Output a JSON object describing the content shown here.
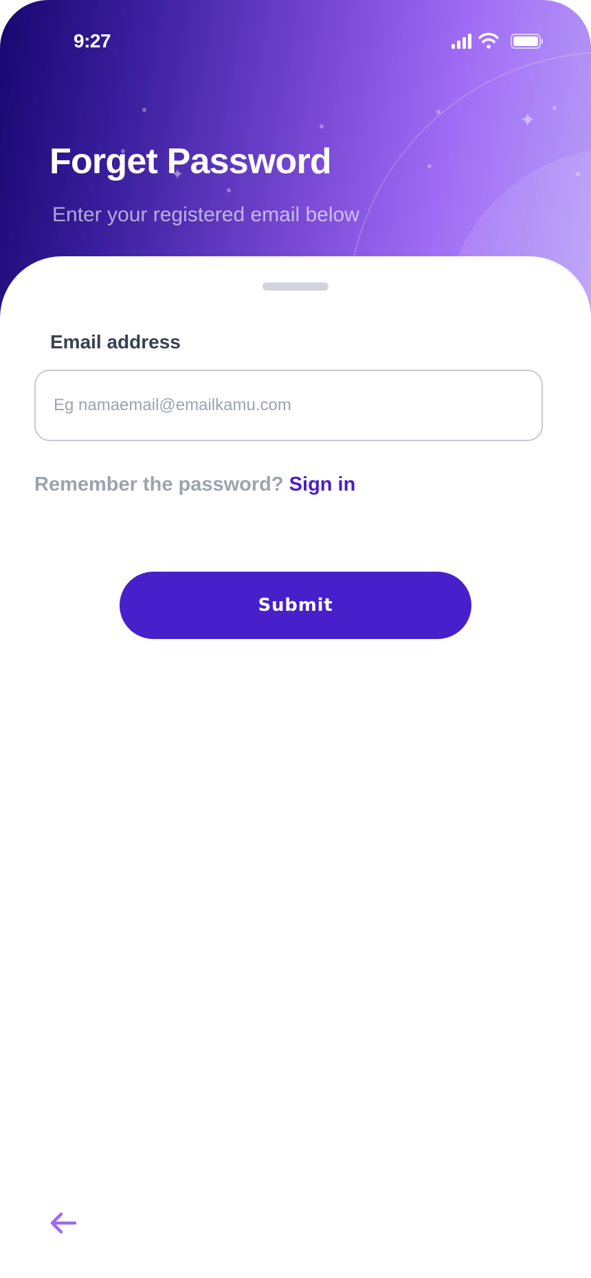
{
  "status_bar": {
    "time": "9:27",
    "icons": [
      "signal-icon",
      "wifi-icon",
      "battery-icon"
    ]
  },
  "header": {
    "title": "Forget Password",
    "subtitle": "Enter your registered email below"
  },
  "form": {
    "email_label": "Email address",
    "email_value": "",
    "email_placeholder": "Eg namaemail@emailkamu.com",
    "remember_text": "Remember the password?",
    "signin_label": "Sign in",
    "submit_label": "Submit"
  },
  "footer": {
    "back_icon": "arrow-left-icon"
  },
  "colors": {
    "primary": "#471fcb",
    "link": "#4a1fc7",
    "back_arrow": "#9b6cf0",
    "gradient_start": "#170770",
    "gradient_mid": "#a06cf5",
    "gradient_end": "#b9a3f7",
    "label": "#374151",
    "muted": "#9ca3af"
  }
}
